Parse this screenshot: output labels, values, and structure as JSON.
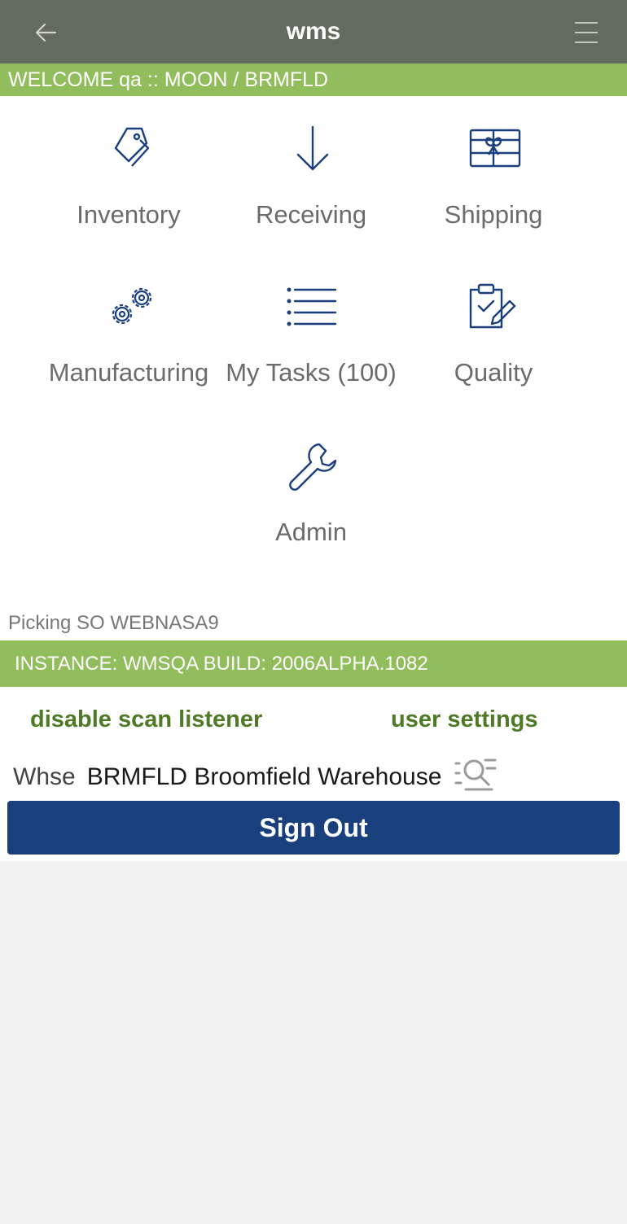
{
  "header": {
    "title": "wms",
    "back_icon": "arrow-left-icon",
    "menu_icon": "hamburger-menu-icon"
  },
  "welcome": "WELCOME qa :: MOON / BRMFLD",
  "menu": {
    "inventory": "Inventory",
    "receiving": "Receiving",
    "shipping": "Shipping",
    "manufacturing": "Manufacturing",
    "my_tasks": "My Tasks (100)",
    "quality": "Quality",
    "admin": "Admin"
  },
  "status": {
    "picking": "Picking SO WEBNASA9",
    "instance": "INSTANCE: WMSQA  BUILD: 2006ALPHA.1082"
  },
  "links": {
    "disable_scan": "disable scan listener",
    "user_settings": "user settings"
  },
  "warehouse": {
    "label": "Whse",
    "value": "BRMFLD Broomfield Warehouse"
  },
  "sign_out": "Sign Out",
  "colors": {
    "header": "#636c5c",
    "accent_green": "#92bd5c",
    "link_green": "#4f7a25",
    "primary_blue": "#1a3f7d",
    "icon_blue": "#1a3f7d"
  }
}
